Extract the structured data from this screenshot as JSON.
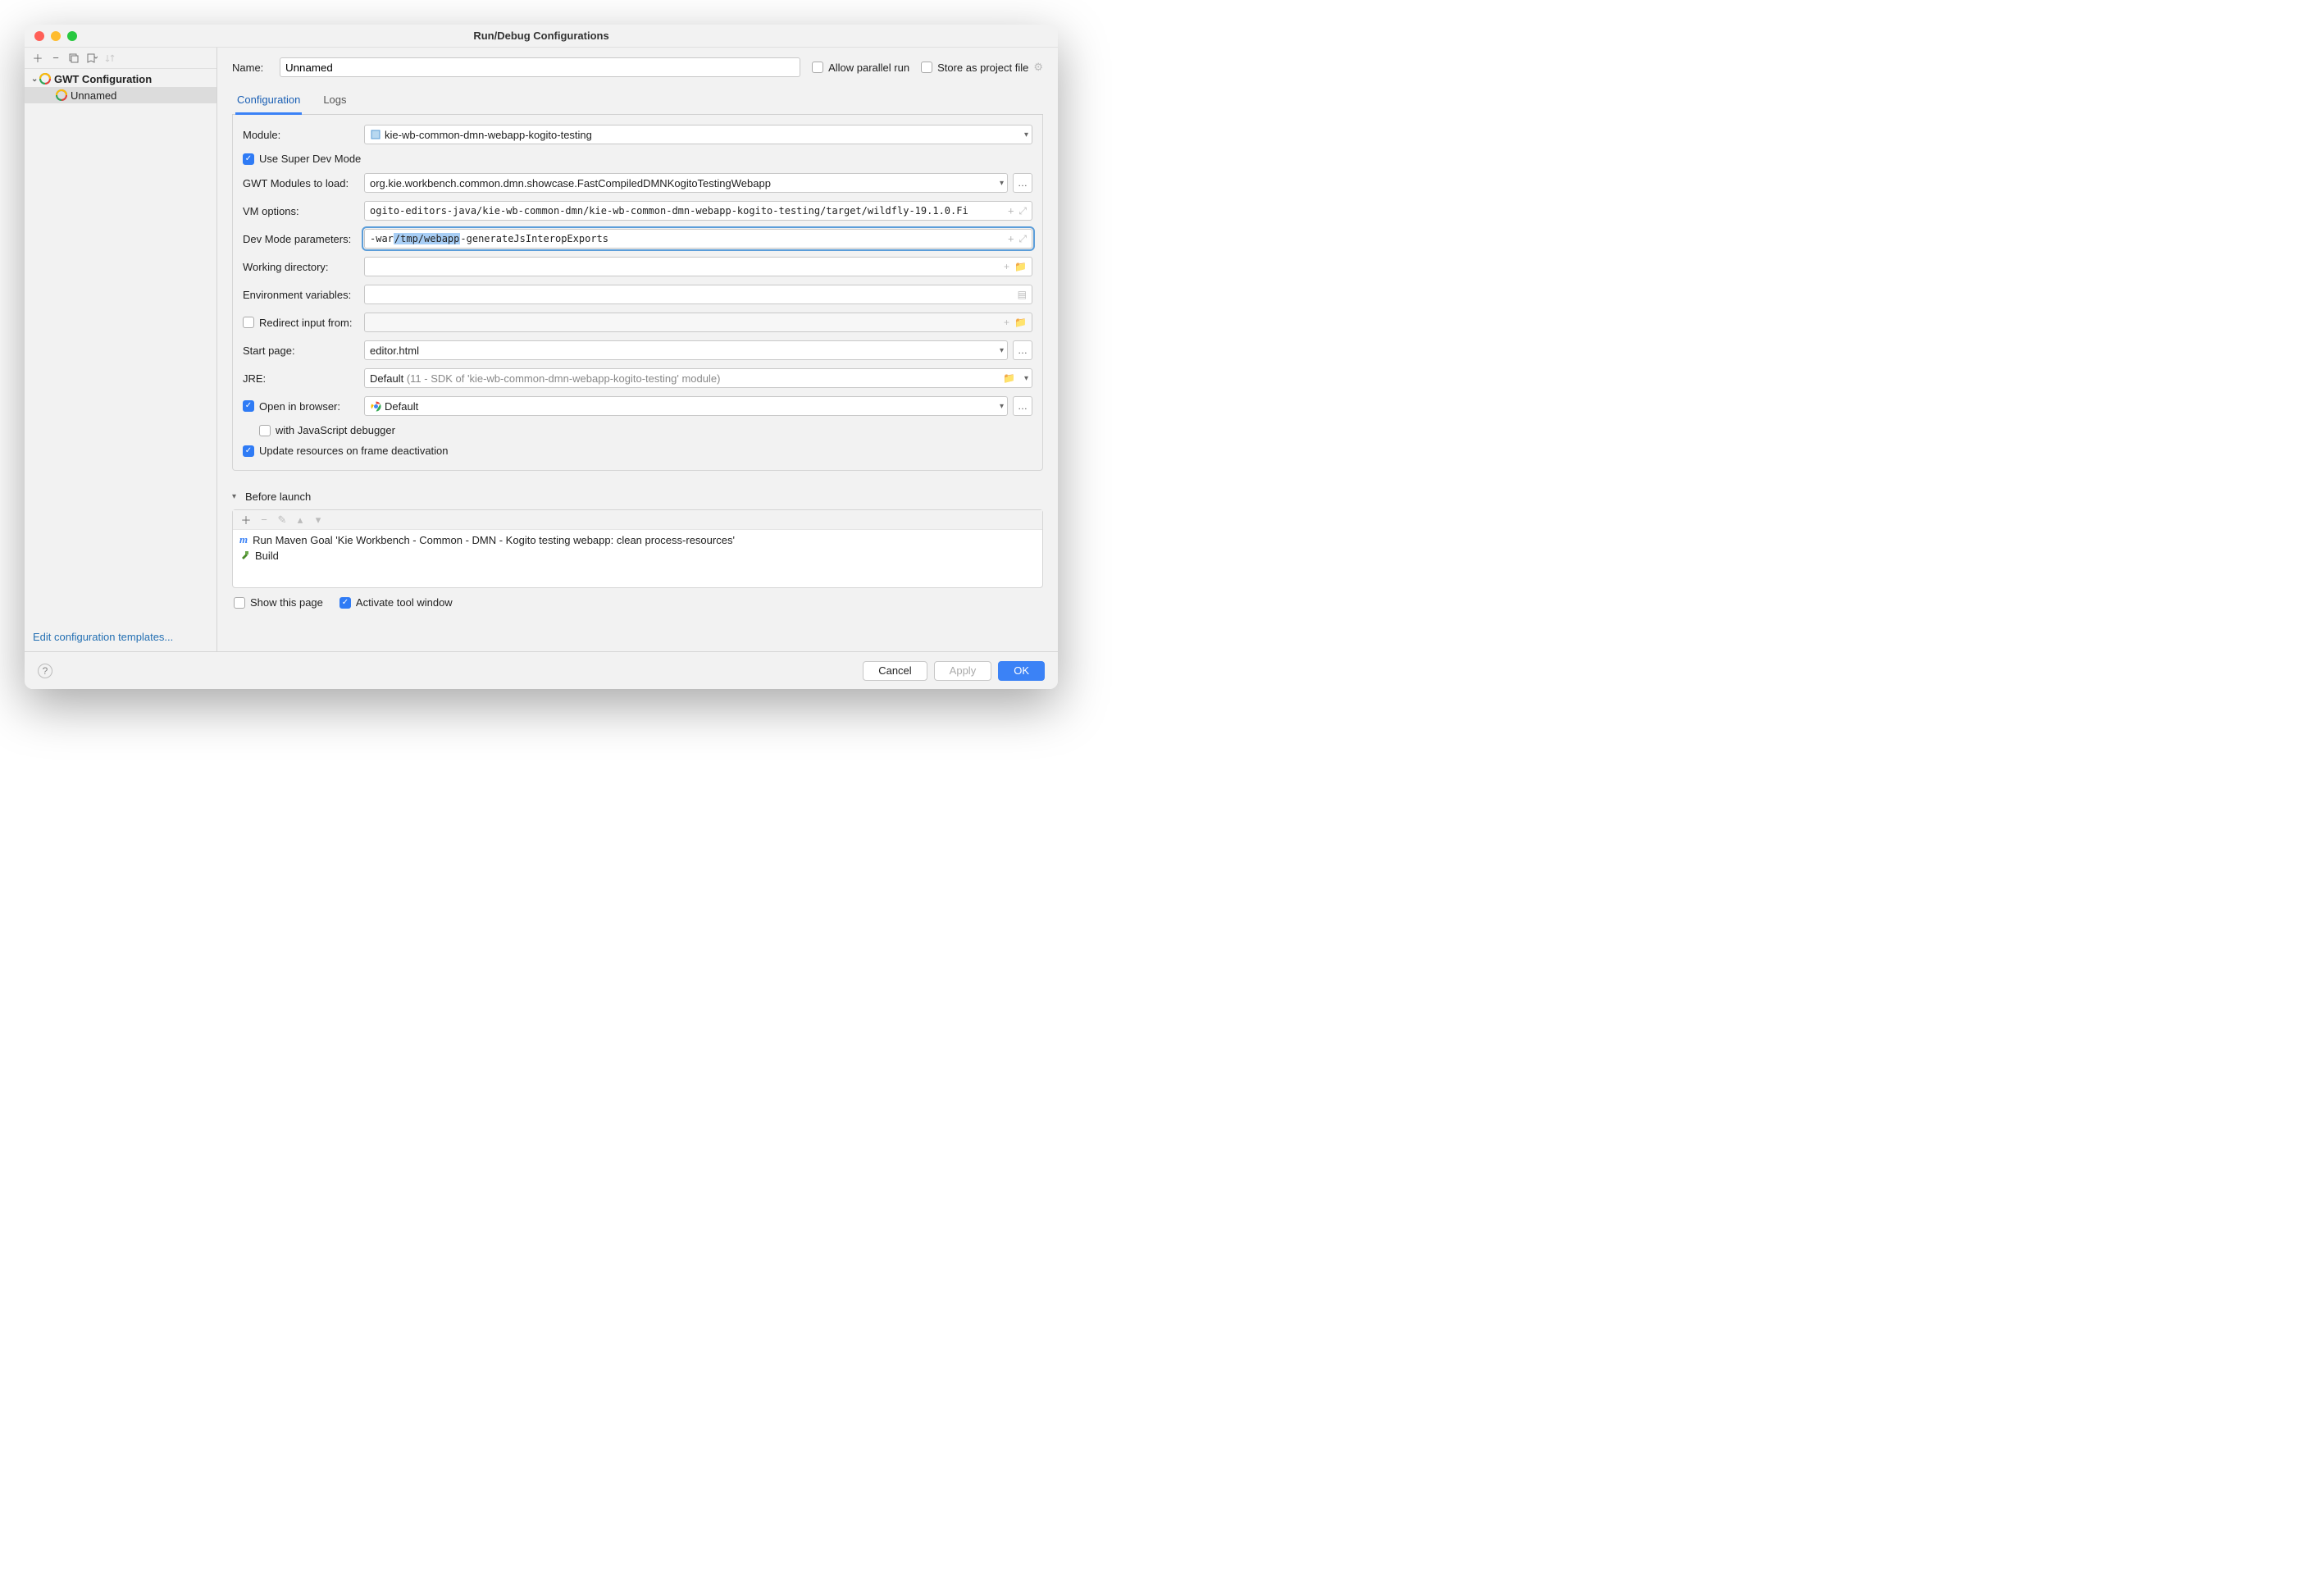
{
  "title": "Run/Debug Configurations",
  "sidebar": {
    "group": "GWT Configuration",
    "item": "Unnamed",
    "edit_templates": "Edit configuration templates..."
  },
  "name_label": "Name:",
  "name_value": "Unnamed",
  "allow_parallel": "Allow parallel run",
  "store_project": "Store as project file",
  "tabs": {
    "config": "Configuration",
    "logs": "Logs"
  },
  "labels": {
    "module": "Module:",
    "super_dev": "Use Super Dev Mode",
    "gwt_modules": "GWT Modules to load:",
    "vm": "VM options:",
    "dev_params": "Dev Mode parameters:",
    "workdir": "Working directory:",
    "env": "Environment variables:",
    "redirect": "Redirect input from:",
    "start_page": "Start page:",
    "jre": "JRE:",
    "open_browser": "Open in browser:",
    "js_debugger": "with JavaScript debugger",
    "update_res": "Update resources on frame deactivation"
  },
  "values": {
    "module": "kie-wb-common-dmn-webapp-kogito-testing",
    "gwt_modules": "org.kie.workbench.common.dmn.showcase.FastCompiledDMNKogitoTestingWebapp",
    "vm": "ogito-editors-java/kie-wb-common-dmn/kie-wb-common-dmn-webapp-kogito-testing/target/wildfly-19.1.0.Fi",
    "dev_prefix": "-war ",
    "dev_sel": "/tmp/webapp",
    "dev_suffix": " -generateJsInteropExports",
    "start_page": "editor.html",
    "jre_main": "Default ",
    "jre_grey": "(11 - SDK of 'kie-wb-common-dmn-webapp-kogito-testing' module)",
    "browser": "Default"
  },
  "before_launch": {
    "title": "Before launch",
    "maven": "Run Maven Goal 'Kie Workbench - Common - DMN - Kogito testing webapp: clean process-resources'",
    "build": "Build"
  },
  "show_page": "Show this page",
  "activate_tool": "Activate tool window",
  "footer": {
    "cancel": "Cancel",
    "apply": "Apply",
    "ok": "OK"
  }
}
